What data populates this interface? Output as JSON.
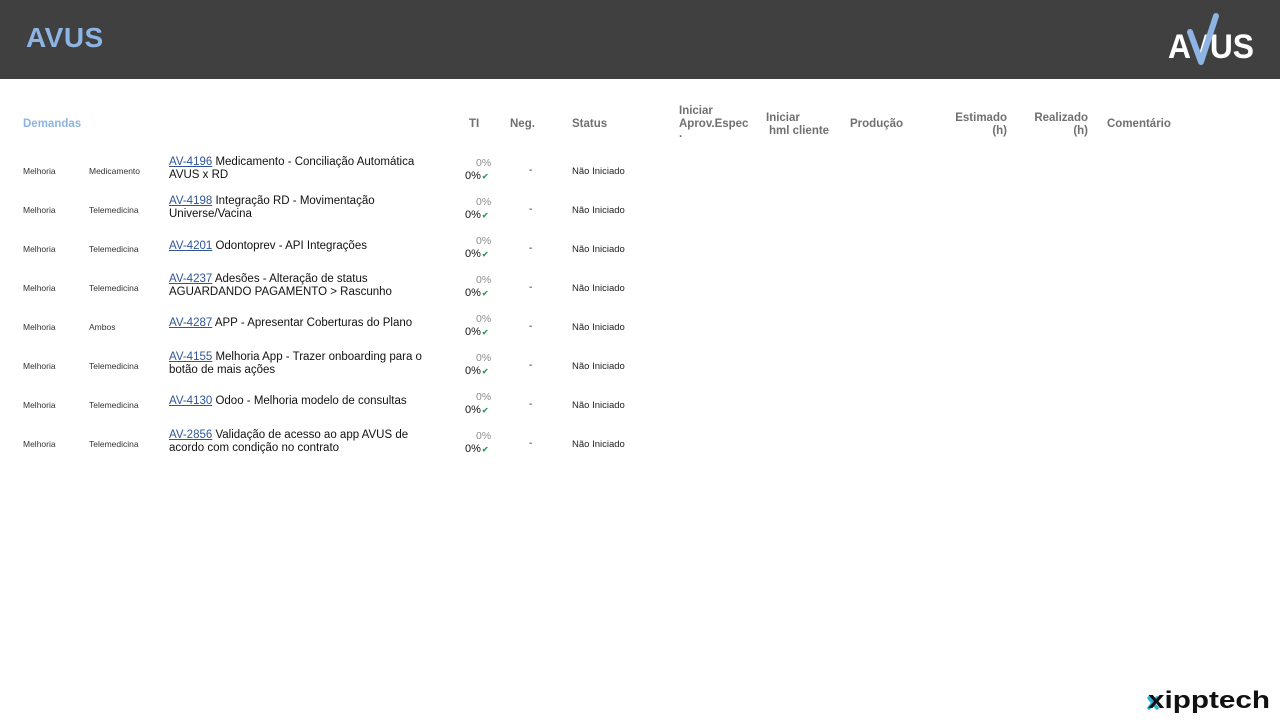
{
  "header": {
    "title": "AVUS",
    "logo_text": "AVUS"
  },
  "table": {
    "columns": {
      "demandas": "Demandas",
      "ti": "TI",
      "neg": "Neg.",
      "status": "Status",
      "iniciar_aprov": [
        "Iniciar",
        "Aprov.Espec",
        "."
      ],
      "iniciar_hml": [
        "Iniciar",
        "hml cliente"
      ],
      "producao": "Produção",
      "estimado": [
        "Estimado",
        "(h)"
      ],
      "realizado": [
        "Realizado",
        "(h)"
      ],
      "comentario": "Comentário"
    },
    "rows": [
      {
        "category": "Melhoria",
        "subcategory": "Medicamento",
        "ticket": "AV-4196",
        "title": " Medicamento - Conciliação Automática AVUS x RD",
        "ti_planned": "0%",
        "ti_done": "0%",
        "neg": "-",
        "status": "Não Iniciado"
      },
      {
        "category": "Melhoria",
        "subcategory": "Telemedicina",
        "ticket": "AV-4198",
        "title": " Integração RD - Movimentação Universe/Vacina",
        "ti_planned": "0%",
        "ti_done": "0%",
        "neg": "-",
        "status": "Não Iniciado"
      },
      {
        "category": "Melhoria",
        "subcategory": "Telemedicina",
        "ticket": "AV-4201",
        "title": " Odontoprev - API Integrações",
        "ti_planned": "0%",
        "ti_done": "0%",
        "neg": "-",
        "status": "Não Iniciado"
      },
      {
        "category": "Melhoria",
        "subcategory": "Telemedicina",
        "ticket": "AV-4237",
        "title": " Adesões - Alteração de status AGUARDANDO PAGAMENTO > Rascunho",
        "ti_planned": "0%",
        "ti_done": "0%",
        "neg": "-",
        "status": "Não Iniciado"
      },
      {
        "category": "Melhoria",
        "subcategory": "Ambos",
        "ticket": "AV-4287",
        "title": " APP - Apresentar Coberturas do Plano",
        "ti_planned": "0%",
        "ti_done": "0%",
        "neg": "-",
        "status": "Não Iniciado"
      },
      {
        "category": "Melhoria",
        "subcategory": "Telemedicina",
        "ticket": "AV-4155",
        "title": " Melhoria App - Trazer onboarding para o botão de mais ações",
        "ti_planned": "0%",
        "ti_done": "0%",
        "neg": "-",
        "status": "Não Iniciado"
      },
      {
        "category": "Melhoria",
        "subcategory": "Telemedicina",
        "ticket": "AV-4130",
        "title": " Odoo - Melhoria modelo de consultas",
        "ti_planned": "0%",
        "ti_done": "0%",
        "neg": "-",
        "status": "Não Iniciado"
      },
      {
        "category": "Melhoria",
        "subcategory": "Telemedicina",
        "ticket": "AV-2856",
        "title": " Validação de acesso ao app AVUS de acordo com condição no contrato",
        "ti_planned": "0%",
        "ti_done": "0%",
        "neg": "-",
        "status": "Não Iniciado"
      }
    ]
  },
  "footer": {
    "logo_text": "xipptech"
  },
  "colors": {
    "header_bg": "#404040",
    "accent": "#8eb4e3",
    "link": "#2f5597",
    "check": "#2e9e5b"
  },
  "icons": {
    "row_check": "check-icon"
  }
}
